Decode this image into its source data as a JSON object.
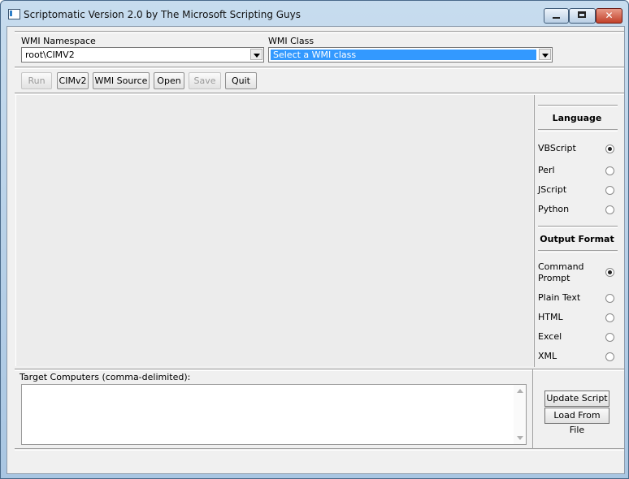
{
  "window": {
    "title": "Scriptomatic Version 2.0 by The Microsoft Scripting Guys",
    "controls": {
      "minimize_icon": "minimize-icon",
      "maximize_icon": "maximize-icon",
      "close_icon": "close-icon",
      "close_glyph": "✕"
    }
  },
  "namespace": {
    "label": "WMI Namespace",
    "value": "root\\CIMV2"
  },
  "wmi_class": {
    "label": "WMI Class",
    "value": "Select a WMI class"
  },
  "toolbar": {
    "run": "Run",
    "cimv2": "CIMv2",
    "wmi_source": "WMI Source",
    "open": "Open",
    "save": "Save",
    "quit": "Quit"
  },
  "language": {
    "heading": "Language",
    "options": [
      {
        "label": "VBScript",
        "selected": true
      },
      {
        "label": "Perl",
        "selected": false
      },
      {
        "label": "JScript",
        "selected": false
      },
      {
        "label": "Python",
        "selected": false
      }
    ]
  },
  "output_format": {
    "heading": "Output Format",
    "options": [
      {
        "label": "Command Prompt",
        "selected": true
      },
      {
        "label": "Plain Text",
        "selected": false
      },
      {
        "label": "HTML",
        "selected": false
      },
      {
        "label": "Excel",
        "selected": false
      },
      {
        "label": "XML",
        "selected": false
      }
    ]
  },
  "target_computers": {
    "label": "Target Computers (comma-delimited):",
    "value": ""
  },
  "actions": {
    "update_script": "Update Script",
    "load_from_file": "Load From File"
  },
  "colors": {
    "selection": "#3399ff",
    "title_bar": "#b9d1ea",
    "close_button": "#c2412a"
  }
}
